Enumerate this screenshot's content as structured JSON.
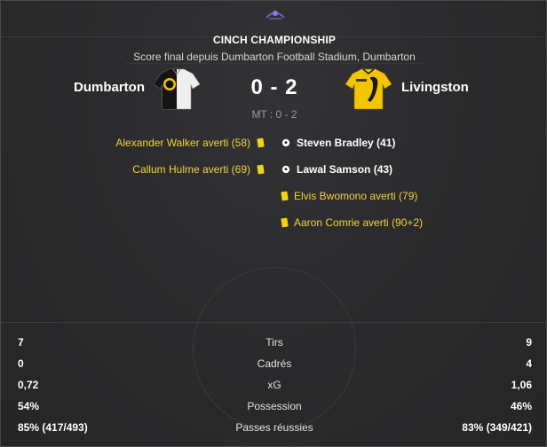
{
  "competition": "CINCH CHAMPIONSHIP",
  "venue_text": "Score final depuis Dumbarton Football Stadium, Dumbarton",
  "home_team": {
    "name": "Dumbarton",
    "kit_colors": [
      "#f2c400",
      "#111111",
      "#ffffff"
    ]
  },
  "away_team": {
    "name": "Livingston",
    "kit_colors": [
      "#f5c400",
      "#111111"
    ]
  },
  "score": "0 - 2",
  "halftime": "MT : 0 - 2",
  "home_events": [
    {
      "text": "Alexander Walker averti (58)",
      "icon": "yellow-card-icon"
    },
    {
      "text": "Callum Hulme averti (69)",
      "icon": "yellow-card-icon"
    }
  ],
  "away_events": [
    {
      "text": "Steven Bradley (41)",
      "icon": "football-icon",
      "type": "goal"
    },
    {
      "text": "Lawal Samson (43)",
      "icon": "football-icon",
      "type": "goal"
    },
    {
      "text": "Elvis Bwomono averti (79)",
      "icon": "yellow-card-icon",
      "type": "card"
    },
    {
      "text": "Aaron Comrie averti (90+2)",
      "icon": "yellow-card-icon",
      "type": "card"
    }
  ],
  "stats": [
    {
      "label": "Tirs",
      "home": "7",
      "away": "9"
    },
    {
      "label": "Cadrés",
      "home": "0",
      "away": "4"
    },
    {
      "label": "xG",
      "home": "0,72",
      "away": "1,06"
    },
    {
      "label": "Possession",
      "home": "54%",
      "away": "46%"
    },
    {
      "label": "Passes réussies",
      "home": "85% (417/493)",
      "away": "83% (349/421)"
    }
  ],
  "colors": {
    "yellow_card": "#f0d416",
    "event_text": "#f0d23c",
    "background": "#2a2a2a"
  }
}
